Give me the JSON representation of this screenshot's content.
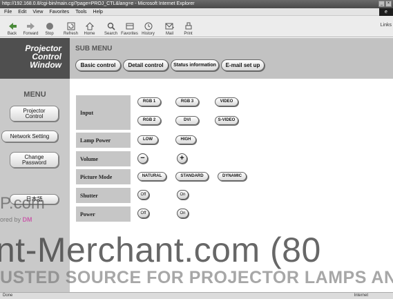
{
  "window": {
    "title": "http://192.168.0.8/cgi-bin/main.cgi?page=PROJ_CTL&lang=e - Microsoft Internet Explorer"
  },
  "menubar": [
    "File",
    "Edit",
    "View",
    "Favorites",
    "Tools",
    "Help"
  ],
  "toolbar": {
    "buttons": [
      {
        "label": "Back",
        "icon": "back-arrow-icon"
      },
      {
        "label": "Forward",
        "icon": "forward-arrow-icon"
      },
      {
        "label": "Stop",
        "icon": "stop-icon"
      },
      {
        "label": "Refresh",
        "icon": "refresh-icon"
      },
      {
        "label": "Home",
        "icon": "home-icon"
      },
      {
        "label": "Search",
        "icon": "search-icon"
      },
      {
        "label": "Favorites",
        "icon": "favorites-icon"
      },
      {
        "label": "History",
        "icon": "history-icon"
      },
      {
        "label": "Mail",
        "icon": "mail-icon"
      },
      {
        "label": "Print",
        "icon": "print-icon"
      }
    ],
    "links_label": "Links"
  },
  "sidebar": {
    "logo_lines": [
      "Projector",
      "Control",
      "Window"
    ],
    "menu_title": "MENU",
    "buttons": [
      {
        "label_lines": [
          "Projector",
          "Control"
        ]
      },
      {
        "label_lines": [
          "Network Setting"
        ]
      },
      {
        "label_lines": [
          "Change",
          "Password"
        ]
      },
      {
        "label_lines": [
          "日本語"
        ]
      }
    ]
  },
  "submenu": {
    "title": "SUB MENU",
    "items": [
      "Basic control",
      "Detail control",
      "Status information",
      "E-mail set up"
    ]
  },
  "controls": {
    "rows": [
      {
        "label": "Input",
        "options": [
          "RGB 1",
          "RGB 3",
          "VIDEO",
          "RGB 2",
          "DVI",
          "S-VIDEO"
        ]
      },
      {
        "label": "Lamp Power",
        "options": [
          "LOW",
          "HIGH"
        ]
      },
      {
        "label": "Volume",
        "options": [
          "−",
          "+"
        ]
      },
      {
        "label": "Picture Mode",
        "options": [
          "NATURAL",
          "STANDARD",
          "DYNAMIC"
        ]
      },
      {
        "label": "Shutter",
        "options": [
          "Off",
          "On"
        ]
      },
      {
        "label": "Power",
        "options": [
          "Off",
          "On"
        ]
      }
    ]
  },
  "watermark": {
    "line1": "P.com",
    "line2_prefix": "ored by",
    "line2_brand": "DM",
    "line3": "nt-Merchant.com (80",
    "line4": "USTED SOURCE FOR PROJECTOR LAMPS AN"
  },
  "statusbar": {
    "left": "Done",
    "zone": "Internet"
  }
}
